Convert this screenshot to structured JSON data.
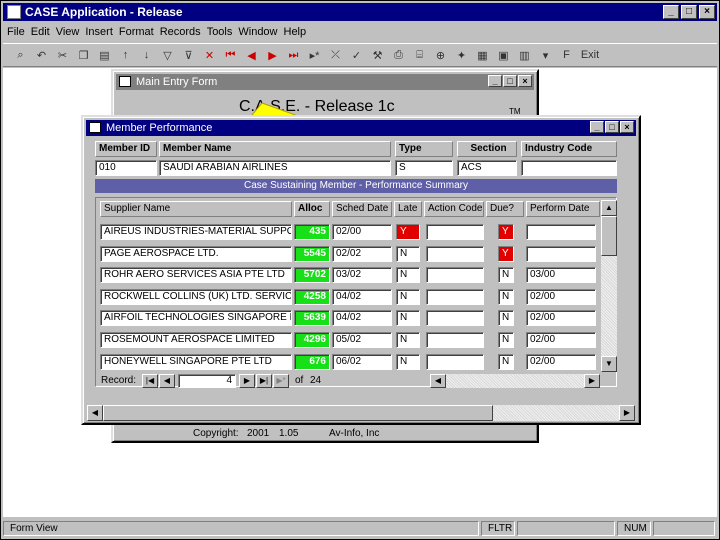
{
  "app": {
    "title": "CASE Application - Release",
    "min": "_",
    "max": "□",
    "close": "×"
  },
  "menu": [
    "File",
    "Edit",
    "View",
    "Insert",
    "Format",
    "Records",
    "Tools",
    "Window",
    "Help"
  ],
  "toolbar": {
    "exit_label": "Exit"
  },
  "main_form": {
    "title": "Main Entry Form",
    "heading": "C.A.S.E. - Release 1c",
    "tm": "TM",
    "footer_copyright": "Copyright:",
    "footer_year": "2001",
    "footer_version": "1.05",
    "footer_company": "Av-Info, Inc"
  },
  "member_form": {
    "title": "Member Performance",
    "headers": {
      "member_id": "Member ID",
      "member_name": "Member Name",
      "type": "Type",
      "section": "Section",
      "industry_code": "Industry Code"
    },
    "values": {
      "member_id": "010",
      "member_name": "SAUDI ARABIAN AIRLINES",
      "type": "S",
      "section": "ACS",
      "industry_code": ""
    },
    "summary_title": "Case Sustaining Member - Performance Summary",
    "columns": [
      "Supplier Name",
      "Alloc",
      "Sched Date",
      "Late",
      "Action Code",
      "Due?",
      "Perform Date"
    ],
    "rows": [
      {
        "supplier": "AIREUS INDUSTRIES-MATERIAL SUPPOI",
        "alloc": "435",
        "sched": "02/00",
        "late": "Y",
        "action": "",
        "due": "Y",
        "perform": "",
        "late_red": true,
        "due_red": true
      },
      {
        "supplier": "PAGE AEROSPACE LTD.",
        "alloc": "5545",
        "sched": "02/02",
        "late": "N",
        "action": "",
        "due": "Y",
        "perform": "",
        "late_red": false,
        "due_red": true
      },
      {
        "supplier": "ROHR AERO SERVICES ASIA PTE LTD",
        "alloc": "5702",
        "sched": "03/02",
        "late": "N",
        "action": "",
        "due": "N",
        "perform": "03/00",
        "late_red": false,
        "due_red": false
      },
      {
        "supplier": "ROCKWELL COLLINS (UK) LTD. SERVICE",
        "alloc": "4258",
        "sched": "04/02",
        "late": "N",
        "action": "",
        "due": "N",
        "perform": "02/00",
        "late_red": false,
        "due_red": false
      },
      {
        "supplier": "AIRFOIL TECHNOLOGIES SINGAPORE PT",
        "alloc": "5639",
        "sched": "04/02",
        "late": "N",
        "action": "",
        "due": "N",
        "perform": "02/00",
        "late_red": false,
        "due_red": false
      },
      {
        "supplier": "ROSEMOUNT AEROSPACE LIMITED",
        "alloc": "4296",
        "sched": "05/02",
        "late": "N",
        "action": "",
        "due": "N",
        "perform": "02/00",
        "late_red": false,
        "due_red": false
      },
      {
        "supplier": "HONEYWELL SINGAPORE PTE LTD",
        "alloc": "676",
        "sched": "06/02",
        "late": "N",
        "action": "",
        "due": "N",
        "perform": "02/00",
        "late_red": false,
        "due_red": false
      }
    ],
    "nav": {
      "label": "Record:",
      "current": "4",
      "of": "of",
      "total": "24"
    }
  },
  "status": {
    "mode": "Form View",
    "fltr": "FLTR",
    "num": "NUM"
  },
  "colors": {
    "title_active": "#000080",
    "title_inactive": "#808080",
    "alloc_green": "#18e018",
    "late_red": "#e00000",
    "summary_bar": "#5f5fa8"
  }
}
